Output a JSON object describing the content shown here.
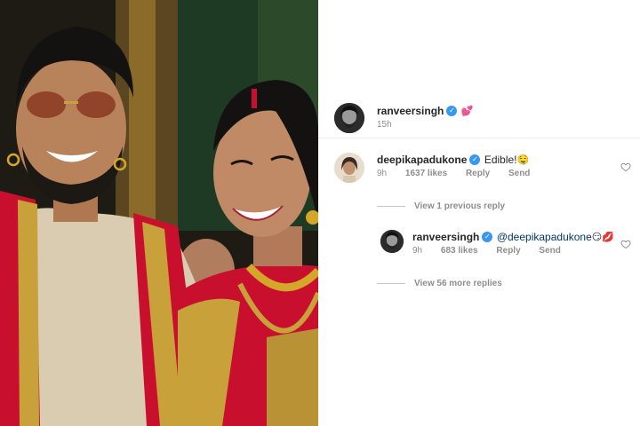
{
  "post": {
    "username": "ranveersingh",
    "verified_emoji": "💕",
    "time": "15h"
  },
  "comments": [
    {
      "username": "deepikapadukone",
      "text": "Edible!",
      "emoji": "🤤",
      "time": "9h",
      "likes": "1637 likes",
      "reply_label": "Reply",
      "send_label": "Send"
    }
  ],
  "view_previous": "View 1 previous reply",
  "reply": {
    "username": "ranveersingh",
    "mention": "@deepikapadukone",
    "emojis": "😏💋",
    "time": "9h",
    "likes": "683 likes",
    "reply_label": "Reply",
    "send_label": "Send"
  },
  "view_more": "View 56 more replies",
  "icons": {
    "verified": "verified-badge-icon",
    "heart": "heart-outline-icon"
  },
  "colors": {
    "verified": "#3897f0",
    "meta": "#8e8e8e",
    "saree_red": "#c8102e",
    "gold": "#c9a13b"
  }
}
